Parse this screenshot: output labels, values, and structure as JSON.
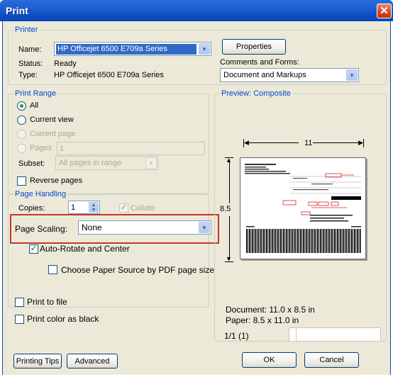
{
  "window": {
    "title": "Print",
    "close_icon": "✕"
  },
  "printer": {
    "legend": "Printer",
    "name_label": "Name:",
    "name_value": "HP Officejet 6500 E709a Series",
    "status_label": "Status:",
    "status_value": "Ready",
    "type_label": "Type:",
    "type_value": "HP Officejet 6500 E709a Series",
    "properties_button": "Properties",
    "comments_label": "Comments and Forms:",
    "comments_value": "Document and Markups"
  },
  "print_range": {
    "legend": "Print Range",
    "all": "All",
    "current_view": "Current view",
    "current_page": "Current page",
    "pages": "Pages",
    "pages_value": "1",
    "subset_label": "Subset:",
    "subset_value": "All pages in range",
    "reverse_pages": "Reverse pages",
    "selected": "All"
  },
  "page_handling": {
    "legend": "Page Handling",
    "copies_label": "Copies:",
    "copies_value": "1",
    "collate": "Collate",
    "page_scaling_label": "Page Scaling:",
    "page_scaling_value": "None",
    "auto_rotate": "Auto-Rotate and Center",
    "auto_rotate_checked": true,
    "paper_source": "Choose Paper Source by PDF page size",
    "paper_source_checked": false
  },
  "preview": {
    "legend": "Preview: Composite",
    "width_dim": "11",
    "height_dim": "8.5",
    "document_size": "Document: 11.0 x 8.5 in",
    "paper_size": "Paper: 8.5 x 11.0 in",
    "page_counter": "1/1 (1)"
  },
  "options": {
    "print_to_file": "Print to file",
    "print_color_black": "Print color as black"
  },
  "footer": {
    "printing_tips": "Printing Tips",
    "advanced": "Advanced",
    "ok": "OK",
    "cancel": "Cancel"
  },
  "colors": {
    "titlebar": "#0b46b6",
    "dialog_bg": "#ece9d8",
    "group_legend": "#0046d5",
    "highlight": "#c0392b"
  }
}
